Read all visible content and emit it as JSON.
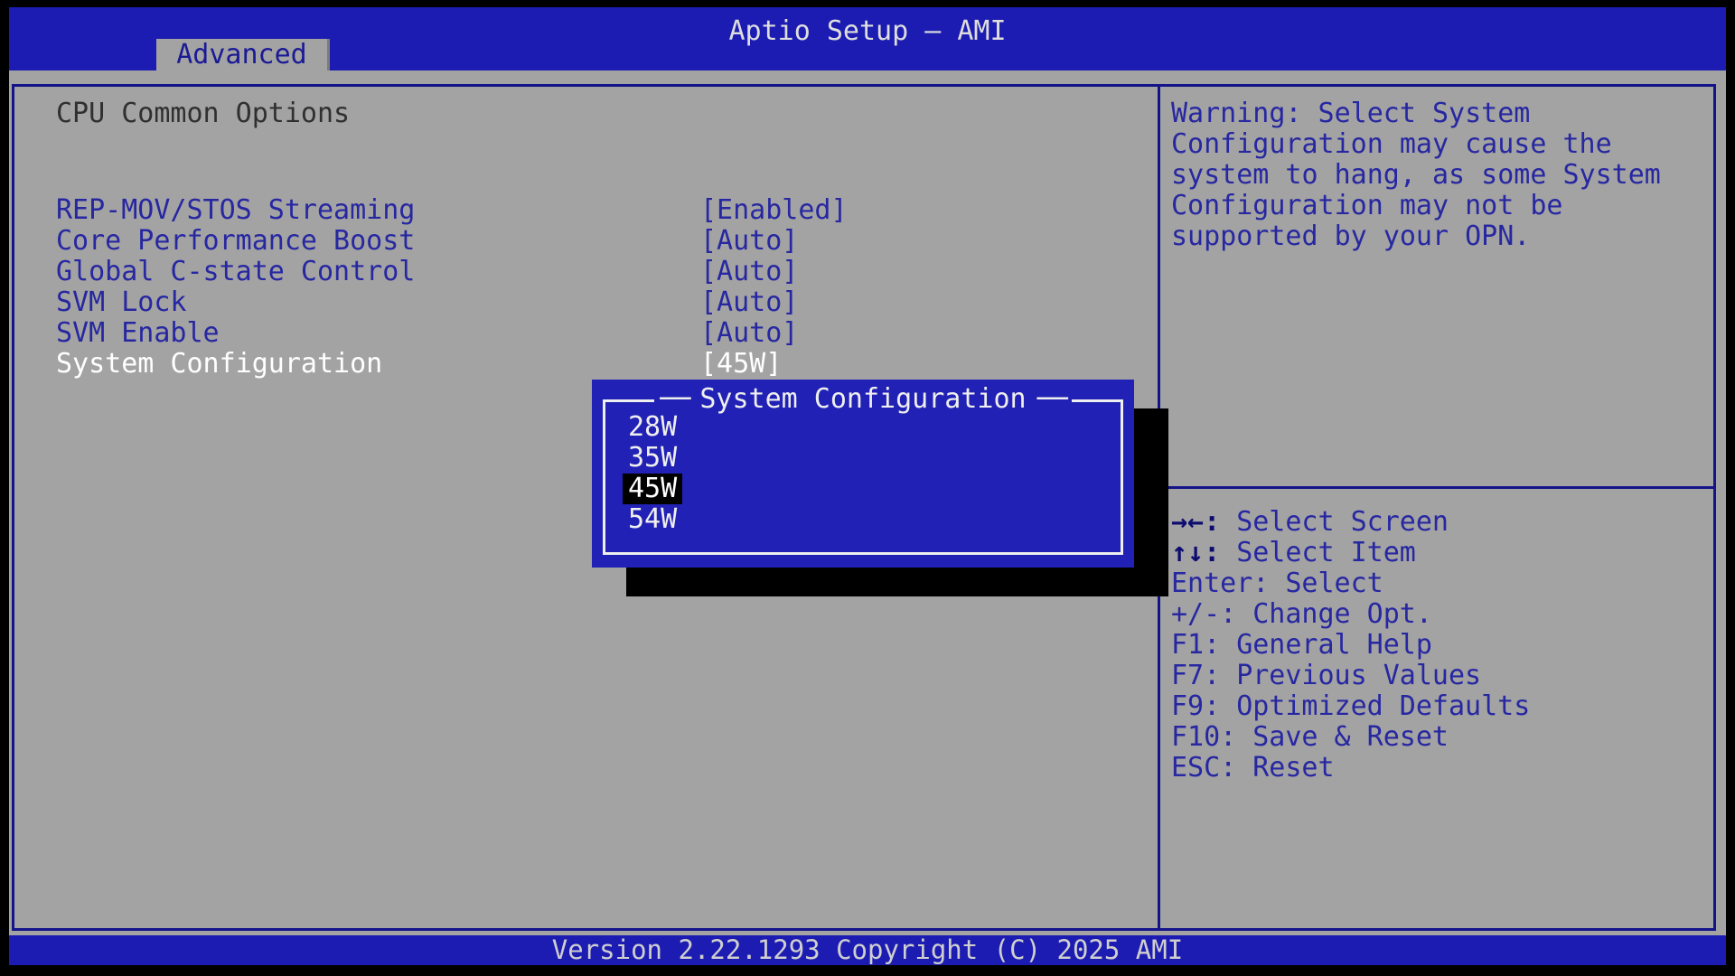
{
  "header": {
    "title": "Aptio Setup – AMI",
    "tab": "Advanced"
  },
  "main": {
    "section_title": "CPU Common Options",
    "options": [
      {
        "label": "REP-MOV/STOS Streaming",
        "value": "[Enabled]",
        "selected": false
      },
      {
        "label": "Core Performance Boost",
        "value": "[Auto]",
        "selected": false
      },
      {
        "label": "Global C-state Control",
        "value": "[Auto]",
        "selected": false
      },
      {
        "label": "SVM Lock",
        "value": "[Auto]",
        "selected": false
      },
      {
        "label": "SVM Enable",
        "value": "[Auto]",
        "selected": false
      },
      {
        "label": "System Configuration",
        "value": "[45W]",
        "selected": true
      }
    ]
  },
  "popup": {
    "title": "System Configuration",
    "title_dash": "──",
    "items": [
      {
        "label": "28W",
        "selected": false
      },
      {
        "label": "35W",
        "selected": false
      },
      {
        "label": "45W",
        "selected": true
      },
      {
        "label": "54W",
        "selected": false
      }
    ]
  },
  "help_panel": {
    "warning_lines": [
      "Warning: Select System",
      "Configuration may cause the",
      "system to hang, as some System",
      "Configuration may not be",
      "supported by your OPN."
    ],
    "keys": [
      {
        "keys": "→←:",
        "label": "Select Screen",
        "bold_keys": true
      },
      {
        "keys": "↑↓:",
        "label": "Select Item",
        "bold_keys": true
      },
      {
        "keys": "Enter:",
        "label": "Select",
        "bold_keys": false
      },
      {
        "keys": "+/-:",
        "label": "Change Opt.",
        "bold_keys": false
      },
      {
        "keys": "F1:",
        "label": "General Help",
        "bold_keys": false
      },
      {
        "keys": "F7:",
        "label": "Previous Values",
        "bold_keys": false
      },
      {
        "keys": "F9:",
        "label": "Optimized Defaults",
        "bold_keys": false
      },
      {
        "keys": "F10:",
        "label": "Save & Reset",
        "bold_keys": false
      },
      {
        "keys": "ESC:",
        "label": "Reset",
        "bold_keys": false
      }
    ]
  },
  "footer": {
    "version_text": "Version 2.22.1293 Copyright (C) 2025 AMI"
  },
  "colors": {
    "header_blue": "#1c1cb2",
    "popup_blue": "#2121b5",
    "panel_gray": "#a3a3a3",
    "border_navy": "#13138a",
    "option_text_navy": "#2727a2",
    "selected_text": "#ffffff",
    "highlight_bg": "#000000"
  }
}
